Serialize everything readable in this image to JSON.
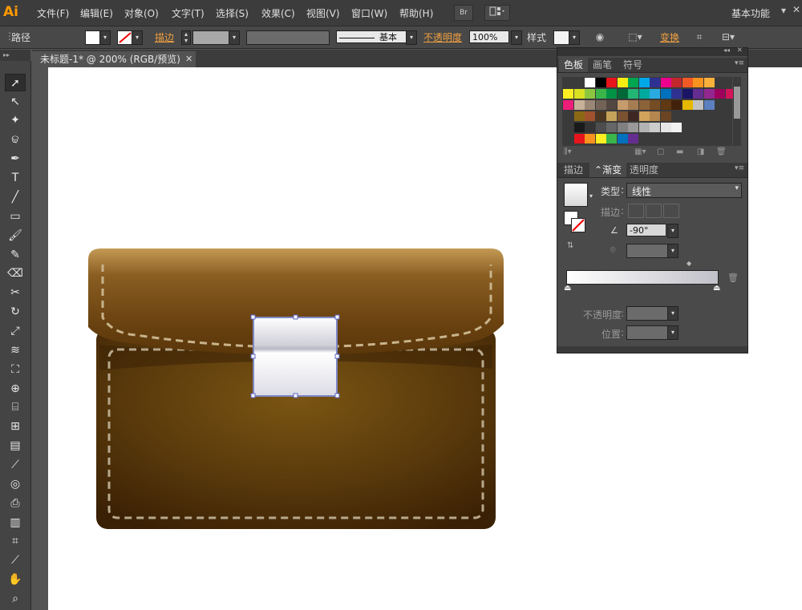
{
  "app": {
    "logo": "Ai"
  },
  "menubar": {
    "items": [
      "文件(F)",
      "编辑(E)",
      "对象(O)",
      "文字(T)",
      "选择(S)",
      "效果(C)",
      "视图(V)",
      "窗口(W)",
      "帮助(H)"
    ],
    "bridge_label": "Br",
    "workspace": "基本功能"
  },
  "control": {
    "path_label": "路径",
    "stroke_label": "描边",
    "stroke_style": "基本",
    "opacity_label": "不透明度",
    "opacity_value": "100%",
    "style_label": "样式",
    "transform_label": "变换"
  },
  "document": {
    "tab_title": "未标题-1* @ 200% (RGB/预览)"
  },
  "panels": {
    "top_tabs": [
      "色板",
      "画笔",
      "符号"
    ],
    "bottom_tabs": [
      "描边",
      "渐变",
      "透明度"
    ],
    "gradient": {
      "type_label": "类型",
      "type_value": "线性",
      "stroke_label": "描边",
      "angle_value": "-90°",
      "opacity_label": "不透明度",
      "position_label": "位置"
    }
  },
  "colors": {
    "swatch_row1": [
      "#ffffff",
      "#000000",
      "#e8141b",
      "#f7ec13",
      "#00a650",
      "#00a8e8",
      "#2e3192",
      "#ec008c",
      "#c1272d",
      "#f15a24",
      "#f7931e",
      "#fbb03b"
    ],
    "swatch_row2": [
      "#fcee21",
      "#d9e021",
      "#8cc63f",
      "#39b54a",
      "#009245",
      "#006837",
      "#22b573",
      "#00a99d",
      "#29abe2",
      "#0071bc",
      "#2e3192",
      "#1b1464",
      "#662d91",
      "#93278f",
      "#9e005d",
      "#d4145a"
    ],
    "swatch_row3": [
      "#ed1e79",
      "#c7b299",
      "#998675",
      "#736357",
      "#534741",
      "#c69c6d",
      "#a67c52",
      "#8c6239",
      "#754c24",
      "#603813",
      "#42210b",
      "#e6b800",
      "#c2c2c2",
      "#5c7fbf"
    ],
    "swatch_row4": [
      "#8b6914",
      "#a0522d",
      "#4b3621",
      "#c4a35a",
      "#7a5230",
      "#3e2723",
      "#d1a35c",
      "#b5874e",
      "#6b4423"
    ],
    "swatch_row5": [
      "#1a1a1a",
      "#333333",
      "#4d4d4d",
      "#666666",
      "#808080",
      "#999999",
      "#b3b3b3",
      "#cccccc",
      "#e6e6e6",
      "#f2f2f2"
    ],
    "swatch_row6": [
      "#e8141b",
      "#f7931e",
      "#fcee21",
      "#39b54a",
      "#0071bc",
      "#662d91"
    ]
  }
}
